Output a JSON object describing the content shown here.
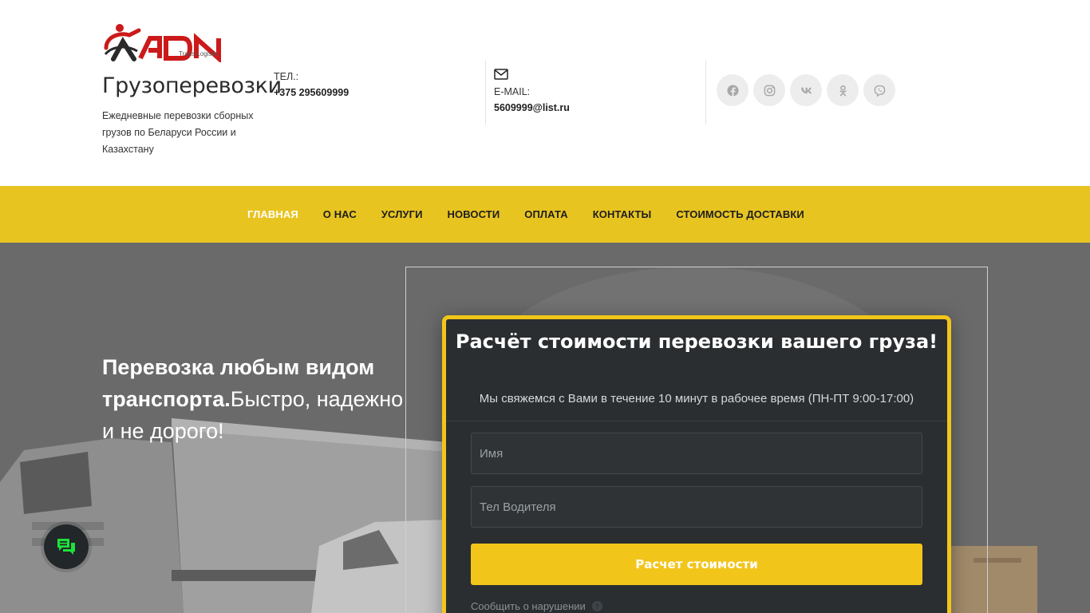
{
  "header": {
    "logo_text": "ADN",
    "logo_tagline": "Trans Logistic",
    "brand_title": "Грузоперевозки",
    "brand_description": "Ежедневные перевозки сборных грузов по Беларуси России и Казахстану",
    "phone": {
      "label": "ТЕЛ.:",
      "value": "+375 295609999"
    },
    "email": {
      "label": "E-MAIL:",
      "value": "5609999@list.ru"
    },
    "socials": [
      "facebook-icon",
      "instagram-icon",
      "vk-icon",
      "odnoklassniki-icon",
      "viber-icon"
    ]
  },
  "nav": {
    "items": [
      {
        "label": "ГЛАВНАЯ",
        "active": true
      },
      {
        "label": "О НАС"
      },
      {
        "label": "УСЛУГИ"
      },
      {
        "label": "НОВОСТИ"
      },
      {
        "label": "ОПЛАТА"
      },
      {
        "label": "КОНТАКТЫ"
      },
      {
        "label": "СТОИМОСТЬ ДОСТАВКИ"
      }
    ]
  },
  "hero": {
    "headline_bold": "Перевозка любым видом транспорта.",
    "headline_rest": "Быстро, надежно и не дорого!"
  },
  "form": {
    "title": "Расчёт стоимости перевозки вашего груза!",
    "subtitle": "Мы свяжемся с Вами в течение 10 минут в рабочее время (ПН-ПТ 9:00-17:00)",
    "name_placeholder": "Имя",
    "phone_placeholder": "Тел Водителя",
    "submit_label": "Расчет стоимости",
    "report_label": "Сообщить о нарушении",
    "report_icon": "?"
  },
  "colors": {
    "nav_bg": "#e8c421",
    "accent": "#f2c51a",
    "form_bg": "#2a2e31",
    "brand_red": "#cc1a1a"
  }
}
